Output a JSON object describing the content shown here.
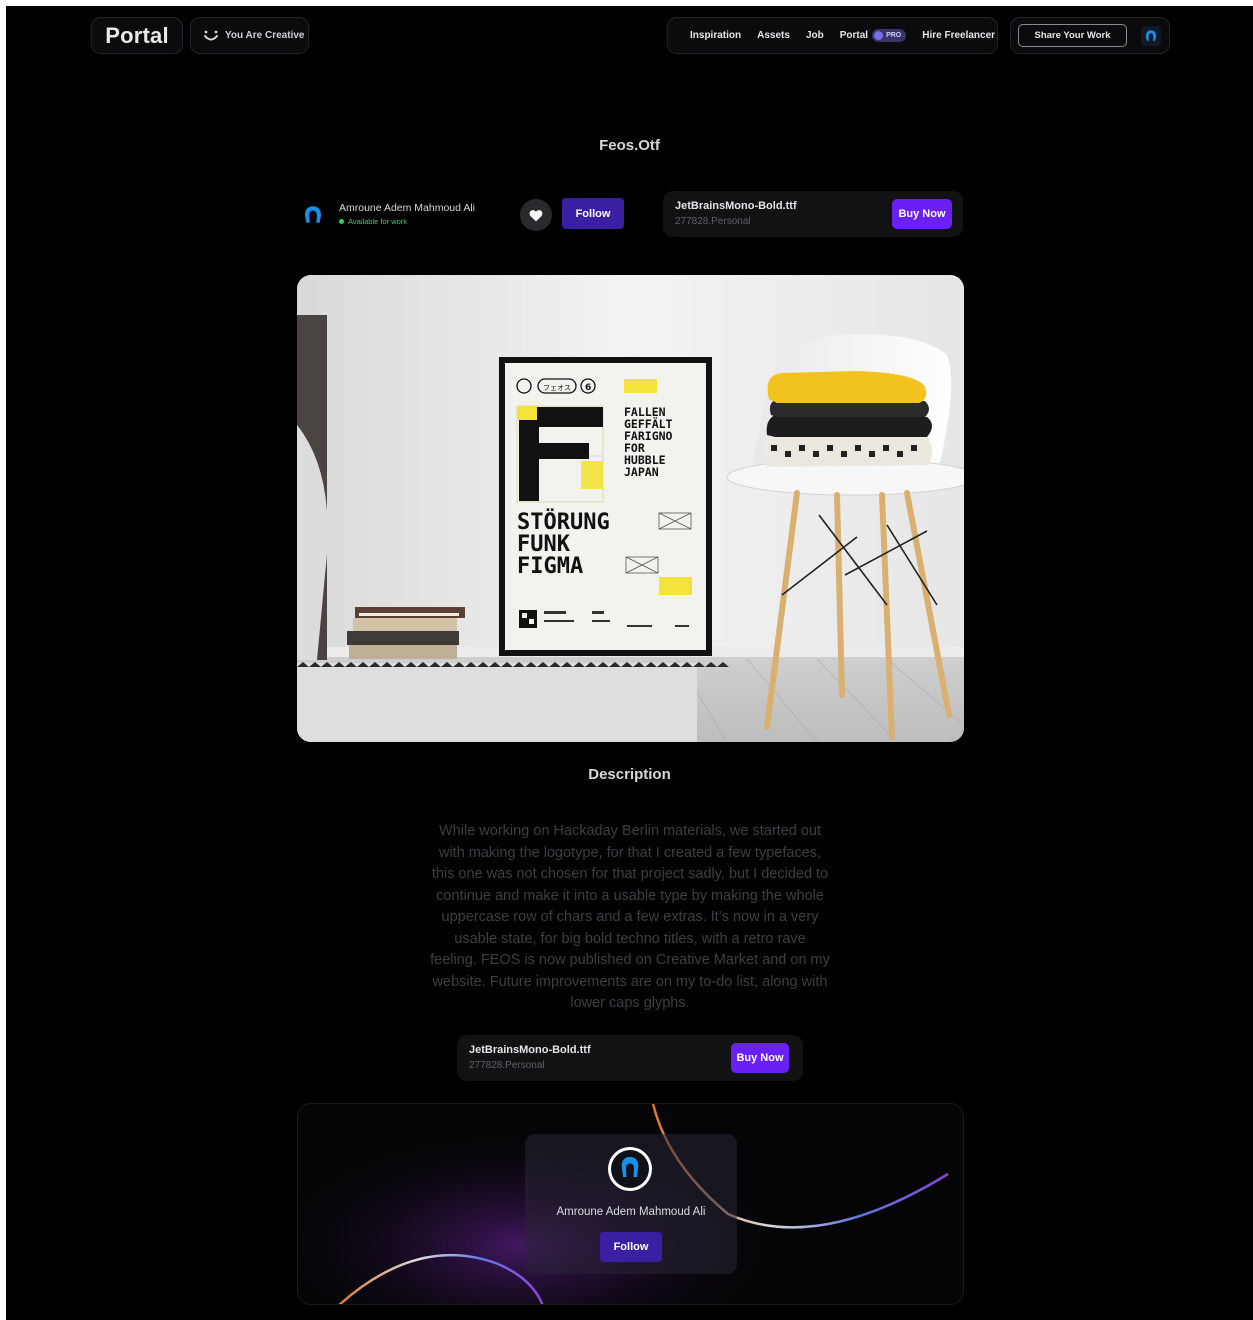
{
  "nav": {
    "logo": "Portal",
    "tagline": "You Are Creative",
    "links": [
      "Inspiration",
      "Assets",
      "Job"
    ],
    "portal_label": "Portal",
    "pro_badge": "PRO",
    "hire_label": "Hire Freelancer",
    "share_label": "Share Your Work"
  },
  "page": {
    "title": "Feos.Otf"
  },
  "author": {
    "name": "Amroune Adem Mahmoud Ali",
    "status": "Available for work",
    "follow_label": "Follow"
  },
  "font_card": {
    "name": "JetBrainsMono-Bold.ttf",
    "license": "277828.Personal",
    "buy_label": "Buy Now"
  },
  "poster": {
    "glyph_tag": "フェオス",
    "number": "6",
    "word_list": [
      "FALLEN",
      "GEFFÄLT",
      "FARIGNO",
      "FOR",
      "HUBBLE",
      "JAPAN"
    ],
    "headline": [
      "STÖRUNG",
      "FUNK",
      "FIGMA"
    ]
  },
  "description": {
    "title": "Description",
    "text": "While working on Hackaday Berlin materials, we started out with making the logotype, for that I created a few typefaces, this one was not chosen for that project sadly, but I decided to continue and make it into a usable type by making the whole uppercase row of chars and a few extras. It’s now in a very usable state, for big bold techno titles, with a retro rave feeling. FEOS is now published on Creative Market and on my website. Future improvements are on my to-do list, along with lower caps glyphs."
  },
  "colors": {
    "background": "#000000",
    "accent_purple": "#6a1ff5",
    "follow_purple": "#3b1fa3",
    "status_green": "#2fd165",
    "avatar_blue": "#1a8fe8"
  }
}
